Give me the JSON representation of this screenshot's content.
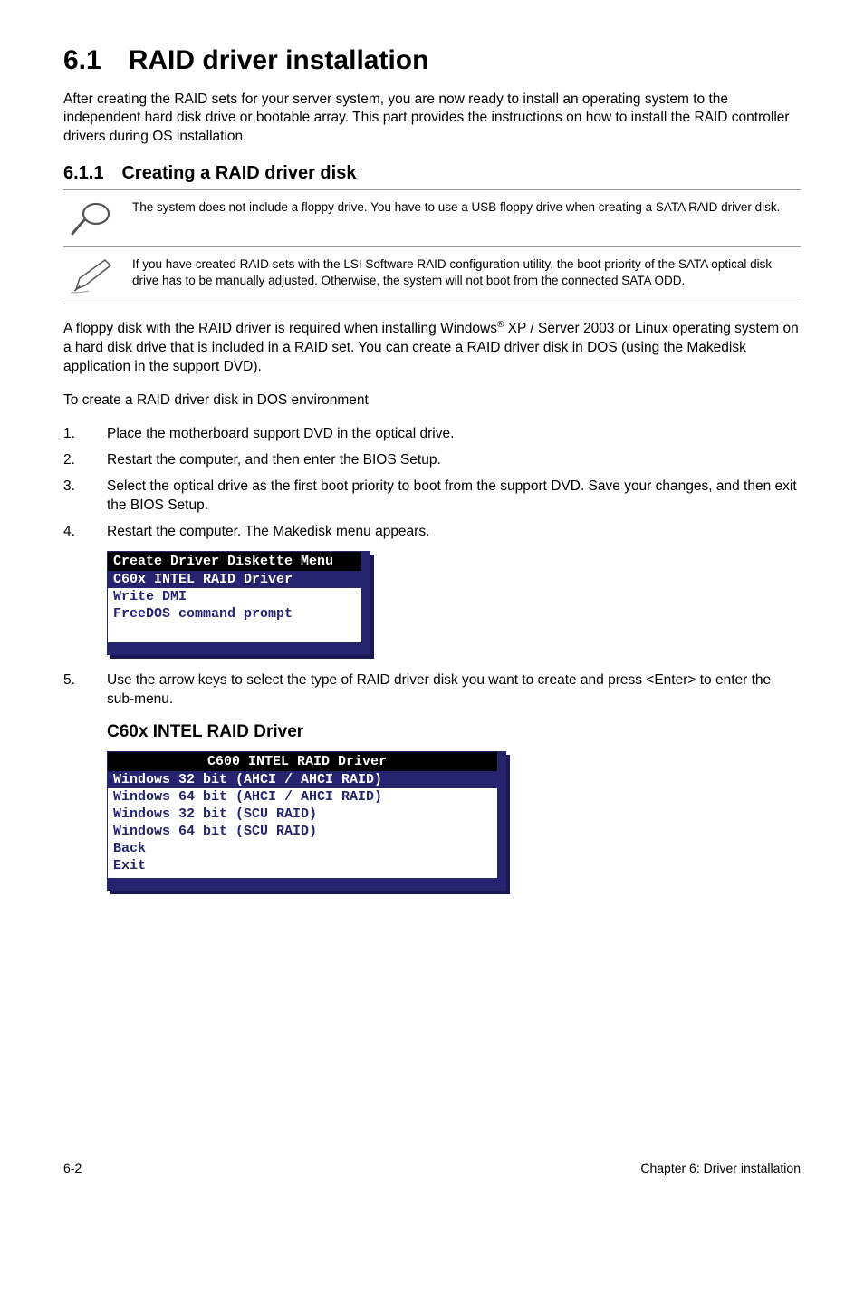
{
  "heading": "6.1 RAID driver installation",
  "intro": "After creating the RAID sets for your server system, you are now ready to install an operating system to the independent hard disk drive or bootable array. This part provides the instructions on how to install the RAID controller drivers during OS installation.",
  "subheading": "6.1.1 Creating a RAID driver disk",
  "note1": "The system does not include a floppy drive. You have to use a USB floppy drive when creating a SATA RAID driver disk.",
  "note2": "If you have created RAID sets with the LSI Software RAID configuration utility, the boot priority of the SATA optical disk drive has to be manually adjusted. Otherwise, the system will not boot from the connected SATA ODD.",
  "body1_pre": "A floppy disk with the RAID driver is required when installing Windows",
  "body1_sup": "®",
  "body1_post": " XP / Server 2003 or Linux operating system on a hard disk drive that is included in a RAID set. You can create a RAID driver disk in DOS (using the Makedisk application in the support DVD).",
  "body2": "To create a RAID driver disk in DOS environment",
  "steps": [
    "Place the motherboard support DVD in the optical drive.",
    "Restart the computer, and then enter the BIOS Setup.",
    "Select the optical drive as the first boot priority to boot from the support DVD. Save your changes, and then exit the BIOS Setup.",
    "Restart the computer. The Makedisk menu appears."
  ],
  "menu1": {
    "title": "Create Driver Diskette Menu",
    "selected": "C60x INTEL RAID Driver",
    "items": [
      "Write DMI",
      "FreeDOS command prompt"
    ]
  },
  "step5_num": "5.",
  "step5": "Use the arrow keys to select the type of RAID driver disk you want to create and press <Enter> to enter the sub-menu.",
  "subheading2": "C60x INTEL RAID Driver",
  "menu2": {
    "title": "C600 INTEL RAID Driver",
    "selected": "Windows 32 bit (AHCI / AHCI RAID)",
    "items": [
      "Windows 64 bit (AHCI / AHCI RAID)",
      "Windows 32 bit (SCU RAID)",
      "Windows 64 bit (SCU RAID)",
      "Back",
      "Exit"
    ]
  },
  "footer_left": "6-2",
  "footer_right": "Chapter 6: Driver installation"
}
